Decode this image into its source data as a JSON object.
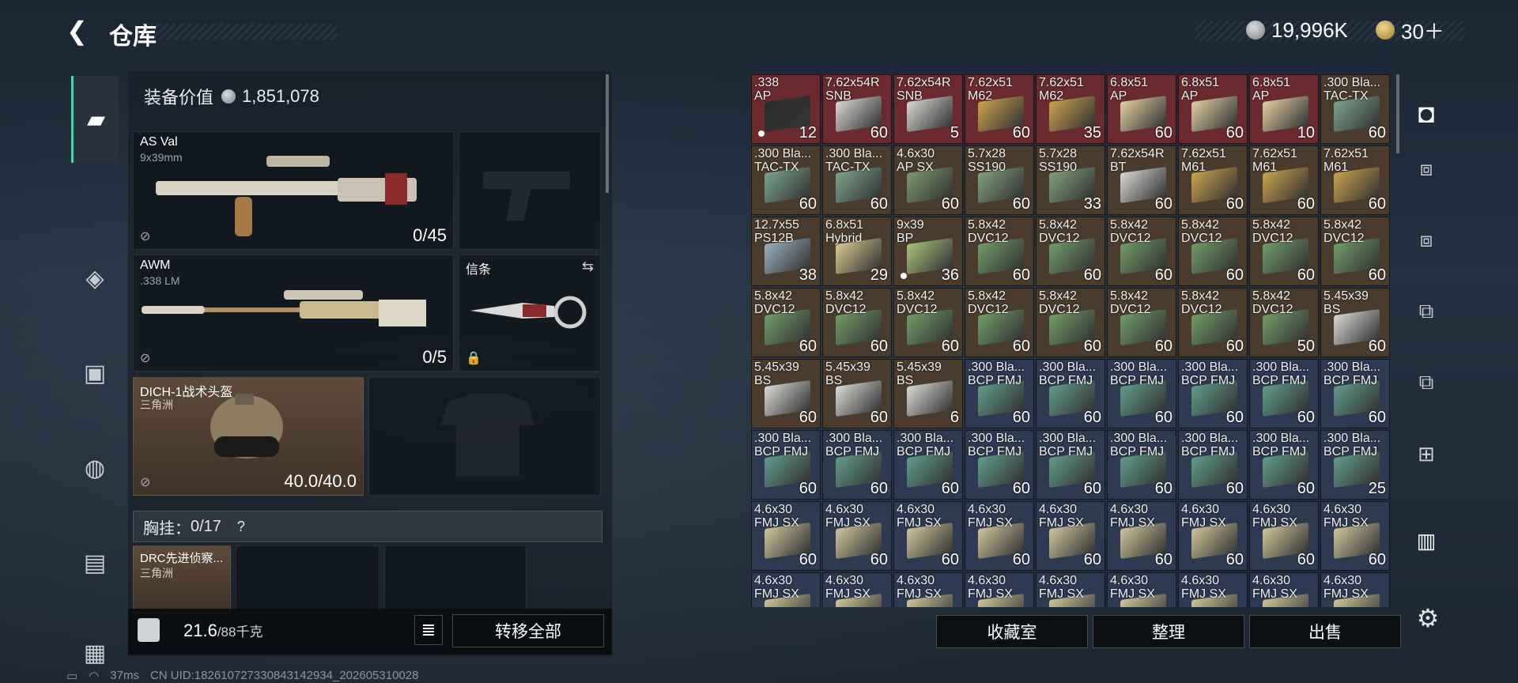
{
  "header": {
    "back_icon": "chevron-left",
    "title": "仓库"
  },
  "currency": {
    "silver": "19,996K",
    "gold": "30＋"
  },
  "left_nav": [
    "pistol-icon",
    "armor-icon",
    "backpack-rig-icon",
    "backpack-icon",
    "clipboard-icon",
    "toolbox-icon"
  ],
  "equip_value": {
    "label": "装备价值",
    "value": "1,851,078"
  },
  "primary": {
    "name": "AS Val",
    "sub": "9x39mm",
    "count": "0/45"
  },
  "secondary": {
    "name": "AWM",
    "sub": ".338 LM",
    "count": "0/5"
  },
  "melee": {
    "name": "信条"
  },
  "helmet": {
    "name": "DICH-1战术头盔",
    "sub": "三角洲",
    "dur": "40.0/40.0"
  },
  "chest": {
    "label": "胸挂：",
    "value": "0/17",
    "help": "?"
  },
  "rig": {
    "name": "DRC先进侦察...",
    "sub": "三角洲"
  },
  "bottom": {
    "weight": "21.6",
    "weight_max": "/88千克",
    "transfer_all": "转移全部"
  },
  "right_buttons": {
    "collection": "收藏室",
    "sort": "整理",
    "sell": "出售"
  },
  "status": {
    "ping": "37ms",
    "uid": "CN UID:18261072733084314293​4_202605310028"
  },
  "colors": {
    "accent": "#3fd6b0",
    "red_bg": "#6a2a2e",
    "brown_bg": "#4b3a2c",
    "blue_bg": "#2e3a52"
  },
  "grid": [
    [
      {
        "l": ".338\nAP",
        "q": "12",
        "bg": "#6b2a2e",
        "box": "#2b2f2a",
        "dot": true
      },
      {
        "l": "7.62x54R\nSNB",
        "q": "60",
        "bg": "#6b2a2e",
        "box": "#d6d6d2"
      },
      {
        "l": "7.62x54R\nSNB",
        "q": "5",
        "bg": "#6b2a2e",
        "box": "#d6d6d2"
      },
      {
        "l": "7.62x51\nM62",
        "q": "60",
        "bg": "#6b2a2e",
        "box": "#c9a24e"
      },
      {
        "l": "7.62x51\nM62",
        "q": "35",
        "bg": "#6b2a2e",
        "box": "#c9a24e"
      },
      {
        "l": "6.8x51\nAP",
        "q": "60",
        "bg": "#6b2a2e",
        "box": "#e0cfa0"
      },
      {
        "l": "6.8x51\nAP",
        "q": "60",
        "bg": "#6b2a2e",
        "box": "#e0cfa0"
      },
      {
        "l": "6.8x51\nAP",
        "q": "10",
        "bg": "#6b2a2e",
        "box": "#e0cfa0"
      },
      {
        "l": ".300 Bla...\nTAC-TX",
        "q": "60",
        "bg": "#4b3b2d",
        "box": "#79a48c"
      }
    ],
    [
      {
        "l": ".300 Bla...\nTAC-TX",
        "q": "60",
        "bg": "#4b3b2d",
        "box": "#79a48c"
      },
      {
        "l": ".300 Bla...\nTAC-TX",
        "q": "60",
        "bg": "#4b3b2d",
        "box": "#79a48c"
      },
      {
        "l": "4.6x30\nAP SX",
        "q": "60",
        "bg": "#4b3b2d",
        "box": "#7a9a6a"
      },
      {
        "l": "5.7x28\nSS190",
        "q": "60",
        "bg": "#4b3b2d",
        "box": "#7fa07a"
      },
      {
        "l": "5.7x28\nSS190",
        "q": "33",
        "bg": "#4b3b2d",
        "box": "#7fa07a"
      },
      {
        "l": "7.62x54R\nBT",
        "q": "60",
        "bg": "#4b3b2d",
        "box": "#d6d6d2"
      },
      {
        "l": "7.62x51\nM61",
        "q": "60",
        "bg": "#4b3b2d",
        "box": "#c9a24e"
      },
      {
        "l": "7.62x51\nM61",
        "q": "60",
        "bg": "#4b3b2d",
        "box": "#c9a24e"
      },
      {
        "l": "7.62x51\nM61",
        "q": "60",
        "bg": "#4b3b2d",
        "box": "#c9a24e"
      }
    ],
    [
      {
        "l": "12.7x55\nPS12B",
        "q": "38",
        "bg": "#4b3b2d",
        "box": "#9ab0c0"
      },
      {
        "l": "6.8x51\nHybrid",
        "q": "29",
        "bg": "#4b3b2d",
        "box": "#d8c890"
      },
      {
        "l": "9x39\nBP",
        "q": "36",
        "bg": "#4b3b2d",
        "box": "#a6c27a",
        "dot": true
      },
      {
        "l": "5.8x42\nDVC12",
        "q": "60",
        "bg": "#4b3b2d",
        "box": "#6f9c66"
      },
      {
        "l": "5.8x42\nDVC12",
        "q": "60",
        "bg": "#4b3b2d",
        "box": "#6f9c66"
      },
      {
        "l": "5.8x42\nDVC12",
        "q": "60",
        "bg": "#4b3b2d",
        "box": "#6f9c66"
      },
      {
        "l": "5.8x42\nDVC12",
        "q": "60",
        "bg": "#4b3b2d",
        "box": "#6f9c66"
      },
      {
        "l": "5.8x42\nDVC12",
        "q": "60",
        "bg": "#4b3b2d",
        "box": "#6f9c66"
      },
      {
        "l": "5.8x42\nDVC12",
        "q": "60",
        "bg": "#4b3b2d",
        "box": "#6f9c66"
      }
    ],
    [
      {
        "l": "5.8x42\nDVC12",
        "q": "60",
        "bg": "#4b3b2d",
        "box": "#6f9c66"
      },
      {
        "l": "5.8x42\nDVC12",
        "q": "60",
        "bg": "#4b3b2d",
        "box": "#6f9c66"
      },
      {
        "l": "5.8x42\nDVC12",
        "q": "60",
        "bg": "#4b3b2d",
        "box": "#6f9c66"
      },
      {
        "l": "5.8x42\nDVC12",
        "q": "60",
        "bg": "#4b3b2d",
        "box": "#6f9c66"
      },
      {
        "l": "5.8x42\nDVC12",
        "q": "60",
        "bg": "#4b3b2d",
        "box": "#6f9c66"
      },
      {
        "l": "5.8x42\nDVC12",
        "q": "60",
        "bg": "#4b3b2d",
        "box": "#6f9c66"
      },
      {
        "l": "5.8x42\nDVC12",
        "q": "60",
        "bg": "#4b3b2d",
        "box": "#6f9c66"
      },
      {
        "l": "5.8x42\nDVC12",
        "q": "50",
        "bg": "#4b3b2d",
        "box": "#6f9c66"
      },
      {
        "l": "5.45x39\nBS",
        "q": "60",
        "bg": "#4b3b2d",
        "box": "#d8d8d4"
      }
    ],
    [
      {
        "l": "5.45x39\nBS",
        "q": "60",
        "bg": "#4b3b2d",
        "box": "#d8d8d4"
      },
      {
        "l": "5.45x39\nBS",
        "q": "60",
        "bg": "#4b3b2d",
        "box": "#d8d8d4"
      },
      {
        "l": "5.45x39\nBS",
        "q": "6",
        "bg": "#4b3b2d",
        "box": "#d8d8d4"
      },
      {
        "l": ".300 Bla...\nBCP FMJ",
        "q": "60",
        "bg": "#2e3a52",
        "box": "#5f9c8a"
      },
      {
        "l": ".300 Bla...\nBCP FMJ",
        "q": "60",
        "bg": "#2e3a52",
        "box": "#5f9c8a"
      },
      {
        "l": ".300 Bla...\nBCP FMJ",
        "q": "60",
        "bg": "#2e3a52",
        "box": "#5f9c8a"
      },
      {
        "l": ".300 Bla...\nBCP FMJ",
        "q": "60",
        "bg": "#2e3a52",
        "box": "#5f9c8a"
      },
      {
        "l": ".300 Bla...\nBCP FMJ",
        "q": "60",
        "bg": "#2e3a52",
        "box": "#5f9c8a"
      },
      {
        "l": ".300 Bla...\nBCP FMJ",
        "q": "60",
        "bg": "#2e3a52",
        "box": "#5f9c8a"
      }
    ],
    [
      {
        "l": ".300 Bla...\nBCP FMJ",
        "q": "60",
        "bg": "#2e3a52",
        "box": "#5f9c8a"
      },
      {
        "l": ".300 Bla...\nBCP FMJ",
        "q": "60",
        "bg": "#2e3a52",
        "box": "#5f9c8a"
      },
      {
        "l": ".300 Bla...\nBCP FMJ",
        "q": "60",
        "bg": "#2e3a52",
        "box": "#5f9c8a"
      },
      {
        "l": ".300 Bla...\nBCP FMJ",
        "q": "60",
        "bg": "#2e3a52",
        "box": "#5f9c8a"
      },
      {
        "l": ".300 Bla...\nBCP FMJ",
        "q": "60",
        "bg": "#2e3a52",
        "box": "#5f9c8a"
      },
      {
        "l": ".300 Bla...\nBCP FMJ",
        "q": "60",
        "bg": "#2e3a52",
        "box": "#5f9c8a"
      },
      {
        "l": ".300 Bla...\nBCP FMJ",
        "q": "60",
        "bg": "#2e3a52",
        "box": "#5f9c8a"
      },
      {
        "l": ".300 Bla...\nBCP FMJ",
        "q": "60",
        "bg": "#2e3a52",
        "box": "#5f9c8a"
      },
      {
        "l": ".300 Bla...\nBCP FMJ",
        "q": "25",
        "bg": "#2e3a52",
        "box": "#5f9c8a"
      }
    ],
    [
      {
        "l": "4.6x30\nFMJ SX",
        "q": "60",
        "bg": "#2e3a52",
        "box": "#cfc49a"
      },
      {
        "l": "4.6x30\nFMJ SX",
        "q": "60",
        "bg": "#2e3a52",
        "box": "#cfc49a"
      },
      {
        "l": "4.6x30\nFMJ SX",
        "q": "60",
        "bg": "#2e3a52",
        "box": "#cfc49a"
      },
      {
        "l": "4.6x30\nFMJ SX",
        "q": "60",
        "bg": "#2e3a52",
        "box": "#cfc49a"
      },
      {
        "l": "4.6x30\nFMJ SX",
        "q": "60",
        "bg": "#2e3a52",
        "box": "#cfc49a"
      },
      {
        "l": "4.6x30\nFMJ SX",
        "q": "60",
        "bg": "#2e3a52",
        "box": "#cfc49a"
      },
      {
        "l": "4.6x30\nFMJ SX",
        "q": "60",
        "bg": "#2e3a52",
        "box": "#cfc49a"
      },
      {
        "l": "4.6x30\nFMJ SX",
        "q": "60",
        "bg": "#2e3a52",
        "box": "#cfc49a"
      },
      {
        "l": "4.6x30\nFMJ SX",
        "q": "60",
        "bg": "#2e3a52",
        "box": "#cfc49a"
      }
    ],
    [
      {
        "l": "4.6x30\nFMJ SX",
        "q": "",
        "bg": "#2e3a52",
        "box": "#cfc49a"
      },
      {
        "l": "4.6x30\nFMJ SX",
        "q": "",
        "bg": "#2e3a52",
        "box": "#cfc49a"
      },
      {
        "l": "4.6x30\nFMJ SX",
        "q": "",
        "bg": "#2e3a52",
        "box": "#cfc49a"
      },
      {
        "l": "4.6x30\nFMJ SX",
        "q": "",
        "bg": "#2e3a52",
        "box": "#cfc49a"
      },
      {
        "l": "4.6x30\nFMJ SX",
        "q": "",
        "bg": "#2e3a52",
        "box": "#cfc49a"
      },
      {
        "l": "4.6x30\nFMJ SX",
        "q": "",
        "bg": "#2e3a52",
        "box": "#cfc49a"
      },
      {
        "l": "4.6x30\nFMJ SX",
        "q": "",
        "bg": "#2e3a52",
        "box": "#cfc49a"
      },
      {
        "l": "4.6x30\nFMJ SX",
        "q": "",
        "bg": "#2e3a52",
        "box": "#cfc49a"
      },
      {
        "l": "4.6x30\nFMJ SX",
        "q": "",
        "bg": "#2e3a52",
        "box": "#cfc49a"
      }
    ]
  ],
  "right_nav": [
    "safe-box-icon",
    "v-case-icon",
    "v-case-icon",
    "iv-case-icon",
    "gti-case-icon",
    "iv-plus-icon",
    "iv-folder-icon"
  ]
}
